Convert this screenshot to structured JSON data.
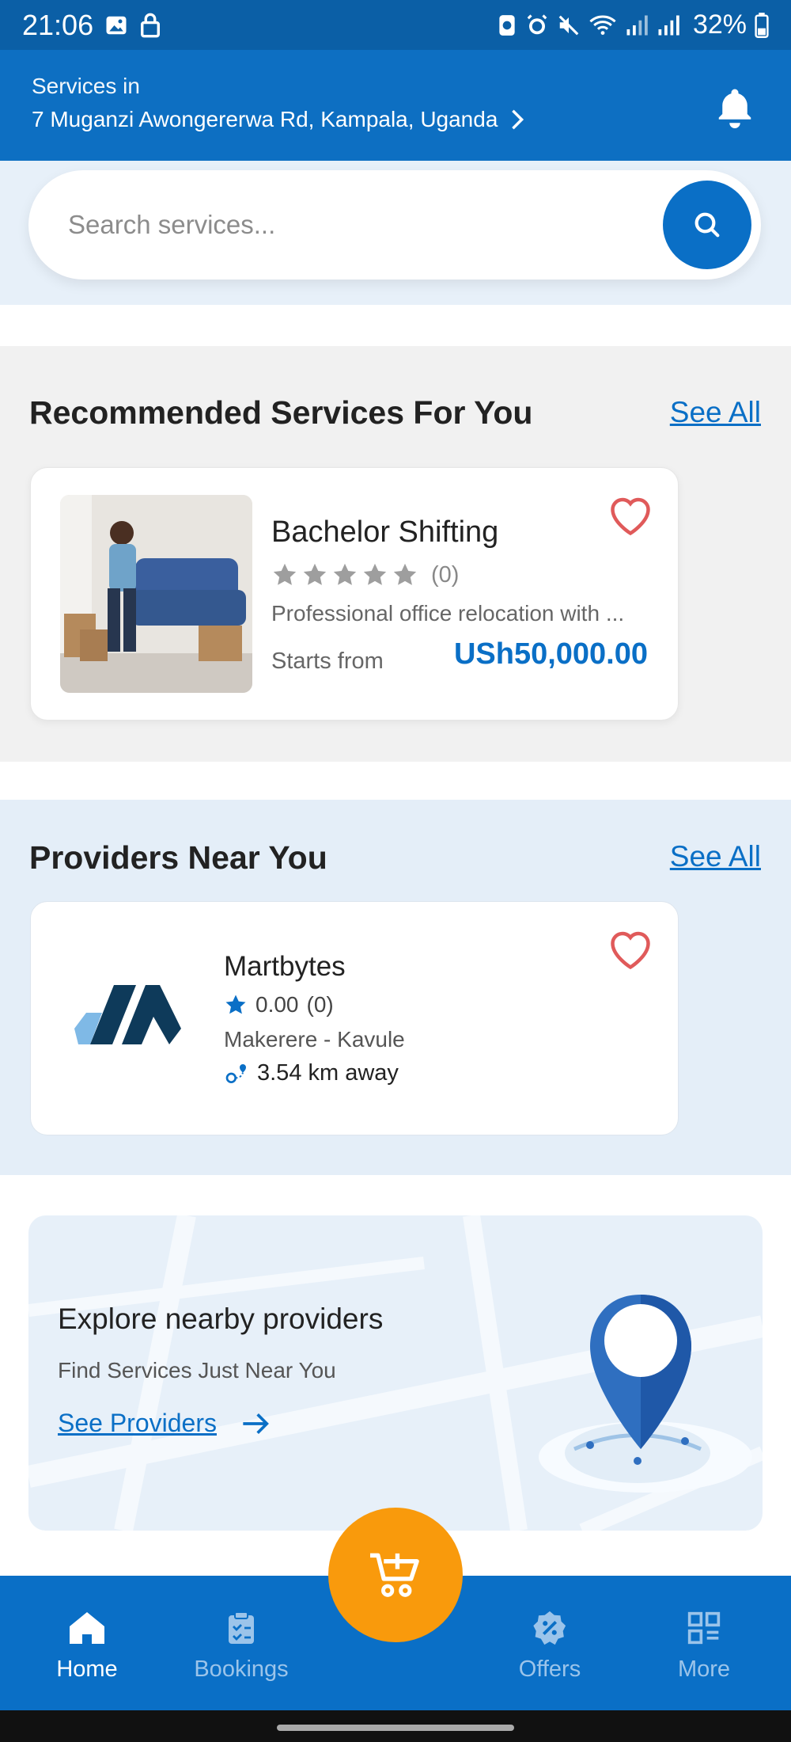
{
  "status_bar": {
    "time": "21:06",
    "battery": "32%"
  },
  "header": {
    "label": "Services in",
    "address": "7 Muganzi Awongererwa Rd, Kampala, Uganda"
  },
  "search": {
    "placeholder": "Search services..."
  },
  "recommended": {
    "title": "Recommended Services For You",
    "see_all": "See All",
    "card": {
      "name": "Bachelor Shifting",
      "rating_count": "(0)",
      "description": "Professional office relocation with ...",
      "starts_from": "Starts from",
      "price": "USh50,000.00"
    }
  },
  "providers": {
    "title": "Providers Near You",
    "see_all": "See All",
    "card": {
      "name": "Martbytes",
      "rating": "0.00",
      "rating_count": "(0)",
      "location": "Makerere - Kavule",
      "distance": "3.54 km away"
    }
  },
  "explore": {
    "title": "Explore nearby providers",
    "subtitle": "Find Services Just Near You",
    "link": "See Providers"
  },
  "nav": {
    "home": "Home",
    "bookings": "Bookings",
    "offers": "Offers",
    "more": "More"
  },
  "colors": {
    "primary": "#0a6fc6",
    "accent": "#f99a0c",
    "heart": "#e05a5a"
  }
}
